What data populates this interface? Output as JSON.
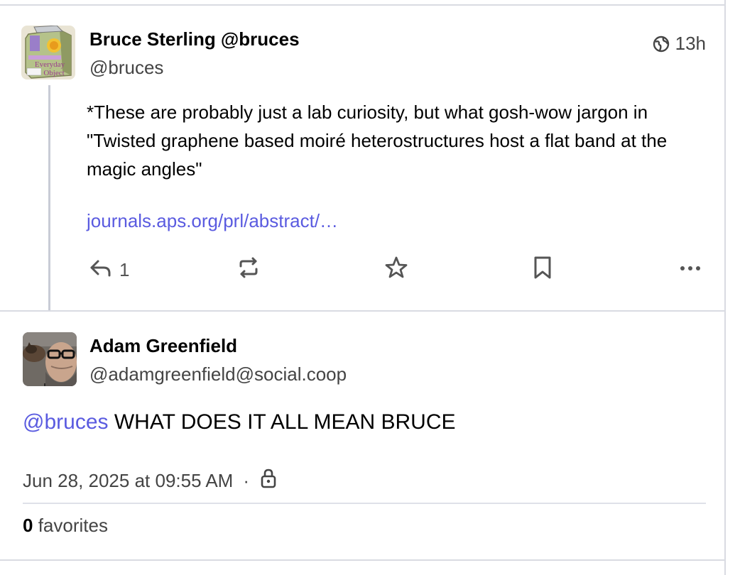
{
  "post1": {
    "display_name": "Bruce Sterling @bruces",
    "handle": "@bruces",
    "timestamp": "13h",
    "visibility_icon": "globe-icon",
    "content": "*These are probably just a lab curiosity, but what gosh-wow jargon in \"Twisted graphene based moiré heterostructures host a flat band at the magic angles\"",
    "link_text": "journals.aps.org/prl/abstract/…",
    "reply_count": "1",
    "avatar_alt": "Everyday Object book cover",
    "avatar_text": "Everyday Object"
  },
  "post2": {
    "display_name": "Adam Greenfield",
    "handle": "@adamgreenfield@social.coop",
    "mention": "@bruces",
    "content": "WHAT DOES IT ALL MEAN BRUCE",
    "datetime": "Jun 28, 2025 at 09:55 AM",
    "separator": "·",
    "visibility_icon": "lock-icon",
    "favorites_count": "0",
    "favorites_label": "favorites"
  },
  "colors": {
    "accent": "#5a5be0",
    "border": "#d9dbe2",
    "muted_text": "#444444",
    "icon": "#555555"
  }
}
